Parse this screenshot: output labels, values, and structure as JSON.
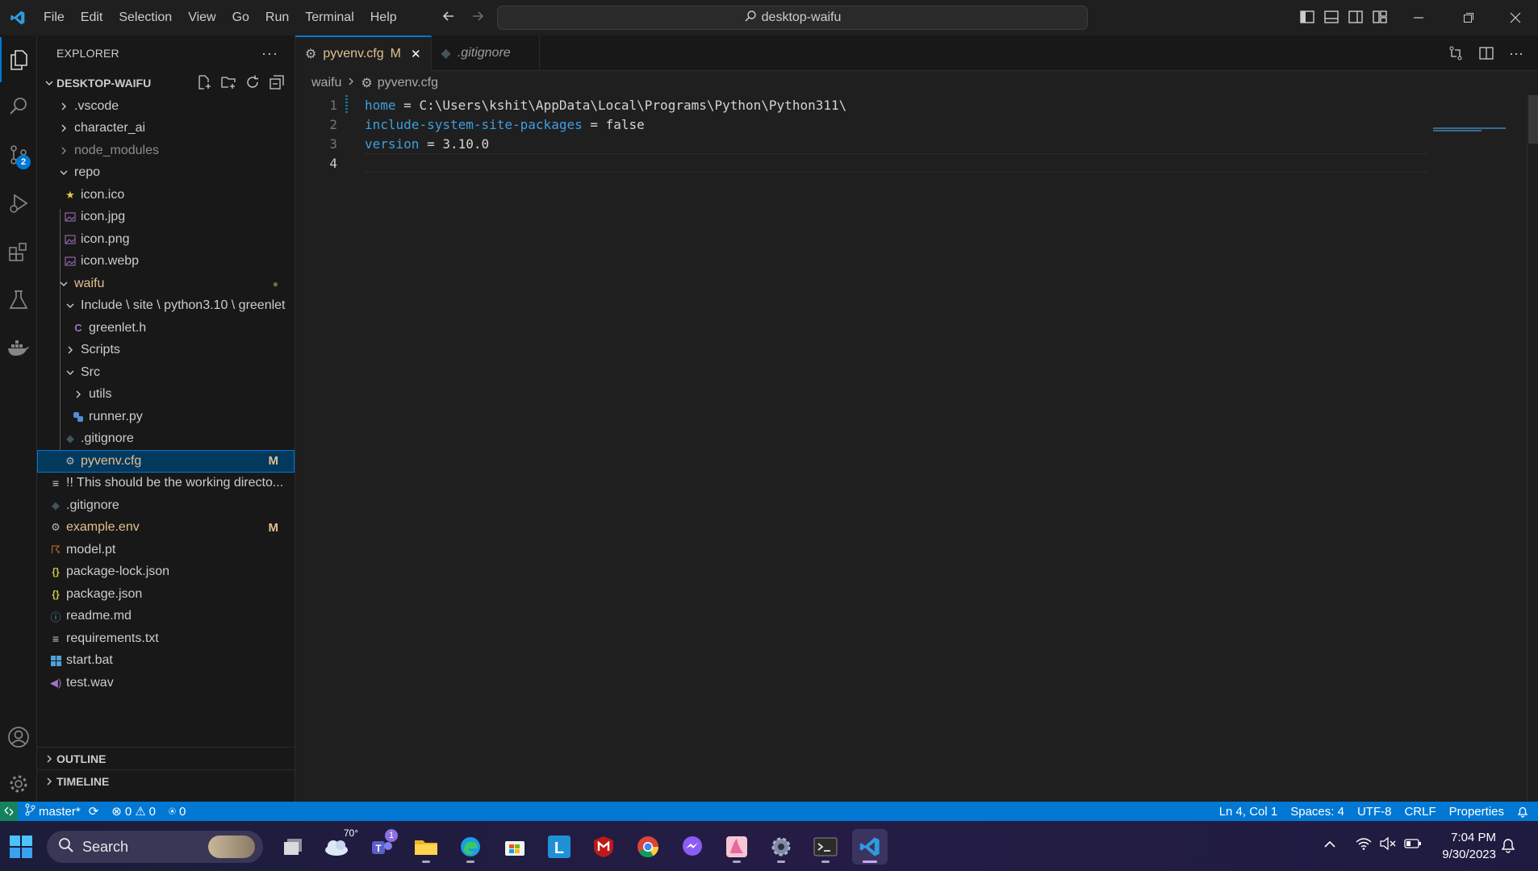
{
  "menu": [
    "File",
    "Edit",
    "Selection",
    "View",
    "Go",
    "Run",
    "Terminal",
    "Help"
  ],
  "command_center": "desktop-waifu",
  "activity_badge": "2",
  "explorer": {
    "title": "EXPLORER",
    "root": "DESKTOP-WAIFU",
    "items": [
      {
        "label": ".vscode"
      },
      {
        "label": "character_ai"
      },
      {
        "label": "node_modules"
      },
      {
        "label": "repo"
      },
      {
        "label": "icon.ico"
      },
      {
        "label": "icon.jpg"
      },
      {
        "label": "icon.png"
      },
      {
        "label": "icon.webp"
      },
      {
        "label": "waifu"
      },
      {
        "label": "Include \\ site \\ python3.10 \\ greenlet"
      },
      {
        "label": "greenlet.h"
      },
      {
        "label": "Scripts"
      },
      {
        "label": "Src"
      },
      {
        "label": "utils"
      },
      {
        "label": "runner.py"
      },
      {
        "label": ".gitignore"
      },
      {
        "label": "pyvenv.cfg",
        "deco": "M"
      },
      {
        "label": "!! This should be the working directo..."
      },
      {
        "label": ".gitignore"
      },
      {
        "label": "example.env",
        "deco": "M"
      },
      {
        "label": "model.pt"
      },
      {
        "label": "package-lock.json"
      },
      {
        "label": "package.json"
      },
      {
        "label": "readme.md"
      },
      {
        "label": "requirements.txt"
      },
      {
        "label": "start.bat"
      },
      {
        "label": "test.wav"
      }
    ],
    "outline": "OUTLINE",
    "timeline": "TIMELINE"
  },
  "tabs": [
    {
      "label": "pyvenv.cfg",
      "deco": "M",
      "close": "✕"
    },
    {
      "label": ".gitignore"
    }
  ],
  "breadcrumb": {
    "folder": "waifu",
    "file": "pyvenv.cfg"
  },
  "code": [
    {
      "num": "1",
      "key": "home",
      "eq": " = ",
      "val": "C:\\Users\\kshit\\AppData\\Local\\Programs\\Python\\Python311\\"
    },
    {
      "num": "2",
      "key": "include-system-site-packages",
      "eq": " = ",
      "val": "false"
    },
    {
      "num": "3",
      "key": "version",
      "eq": " = ",
      "val": "3.10.0"
    },
    {
      "num": "4",
      "key": "",
      "eq": "",
      "val": ""
    }
  ],
  "status": {
    "branch": "master*",
    "errors": "0",
    "warnings": "0",
    "ports": "0",
    "position": "Ln 4, Col 1",
    "spaces": "Spaces: 4",
    "encoding": "UTF-8",
    "eol": "CRLF",
    "language": "Properties"
  },
  "taskbar": {
    "search": "Search",
    "weather": "70°",
    "teams_badge": "1",
    "time": "7:04 PM",
    "date": "9/30/2023"
  },
  "colors": {
    "accent": "#0078d4",
    "modified": "#e2c08d",
    "status_bar": "#0078d4"
  }
}
